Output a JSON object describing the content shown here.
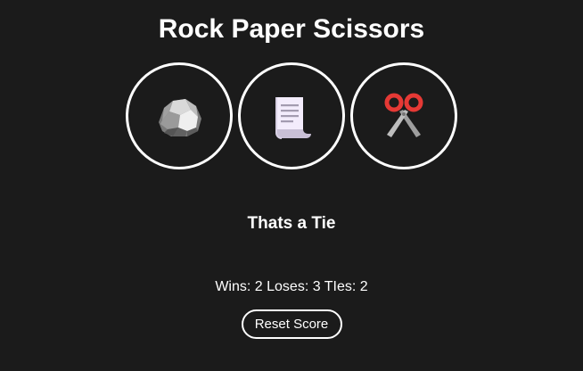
{
  "app": {
    "title": "Rock Paper Scissors"
  },
  "choices": [
    {
      "id": "rock",
      "icon": "rock-icon"
    },
    {
      "id": "paper",
      "icon": "paper-scroll-icon"
    },
    {
      "id": "scissors",
      "icon": "scissors-icon"
    }
  ],
  "result": {
    "message": "Thats a Tie"
  },
  "score": {
    "text": "Wins: 2 Loses: 3 TIes: 2",
    "wins": 2,
    "loses": 3,
    "ties": 2
  },
  "controls": {
    "reset_label": "Reset Score"
  },
  "colors": {
    "background": "#1b1b1b",
    "foreground": "#ffffff",
    "scissors_handle": "#e53935"
  }
}
